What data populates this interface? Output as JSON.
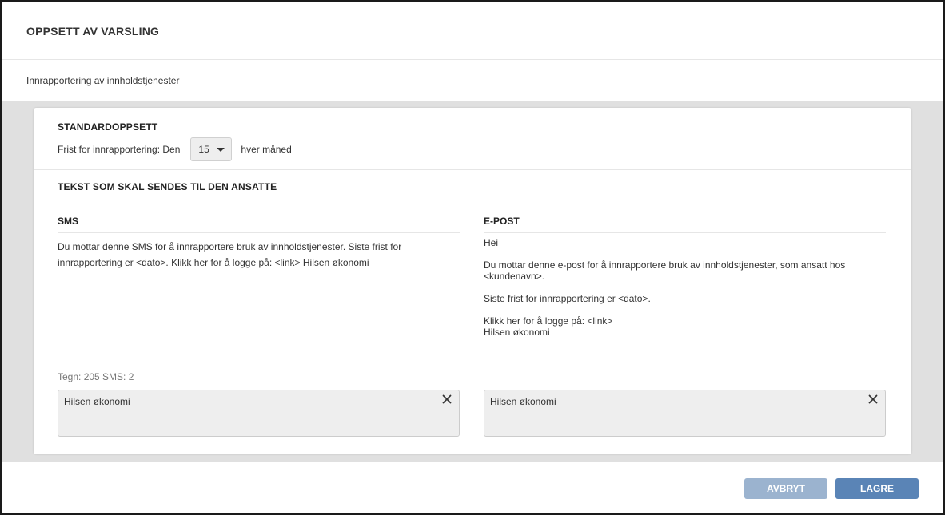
{
  "dialog": {
    "title": "OPPSETT AV VARSLING",
    "subtitle": "Innrapportering av innholdstjenester"
  },
  "standard": {
    "heading": "STANDARDOPPSETT",
    "deadline_prefix": "Frist for innrapportering: Den",
    "day_value": "15",
    "deadline_suffix": "hver måned"
  },
  "message_text": {
    "heading": "TEKST SOM SKAL SENDES TIL DEN ANSATTE",
    "sms": {
      "heading": "SMS",
      "body": "Du mottar denne SMS for å innrapportere bruk av innholdstjenester. Siste frist for innrapportering er <dato>. Klikk her for å logge på: <link> Hilsen økonomi",
      "counter": "Tegn: 205 SMS: 2",
      "signature": "Hilsen økonomi"
    },
    "email": {
      "heading": "E-POST",
      "greeting": "Hei",
      "paragraph1": "Du mottar denne e-post for å innrapportere bruk av innholdstjenester, som ansatt hos <kundenavn>.",
      "paragraph2": "Siste frist for innrapportering er <dato>.",
      "login_line": "Klikk her for å logge på: <link>",
      "closing_line": "Hilsen økonomi",
      "signature": "Hilsen økonomi"
    }
  },
  "footer": {
    "cancel_label": "AVBRYT",
    "save_label": "LAGRE"
  },
  "colors": {
    "primary_button": "#5a84b6",
    "secondary_button": "#9bb3cf",
    "background_gray": "#e0e0e0"
  },
  "icons": {
    "signature_clear": "close-icon",
    "select_caret": "chevron-down-icon"
  }
}
